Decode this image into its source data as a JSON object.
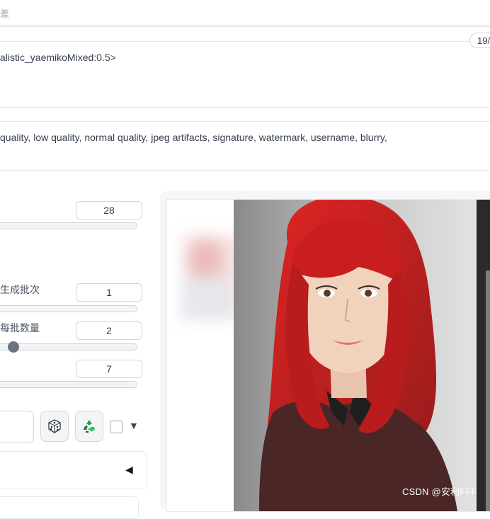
{
  "header": {
    "fragment": "差"
  },
  "prompt": {
    "text": "alistic_yaemikoMixed:0.5>",
    "token_counter": "19/"
  },
  "negative_prompt": {
    "text": "quality, low quality, normal quality, jpeg artifacts, signature, watermark, username, blurry,"
  },
  "sliders": {
    "steps": {
      "label": "",
      "value": "28",
      "fraction": 0.0
    },
    "batch_count": {
      "label": "生成批次",
      "value": "1",
      "fraction": 0.0
    },
    "batch_size": {
      "label": "每批数量",
      "value": "2",
      "fraction": 0.14
    },
    "cfg_scale": {
      "label": "",
      "value": "7",
      "fraction": 0.0
    }
  },
  "seed": {
    "value": "",
    "random_icon": "dice-icon",
    "reuse_icon": "recycle-icon",
    "extra_checkbox_checked": false,
    "extra_arrow": "▼"
  },
  "accordion": {
    "arrow": "◀"
  },
  "gallery": {
    "watermark": "CSDN @安利FFF"
  },
  "colors": {
    "accent_hair": "#c81e1e",
    "slider_thumb": "#6b7280",
    "recycle_green": "#16a34a"
  }
}
